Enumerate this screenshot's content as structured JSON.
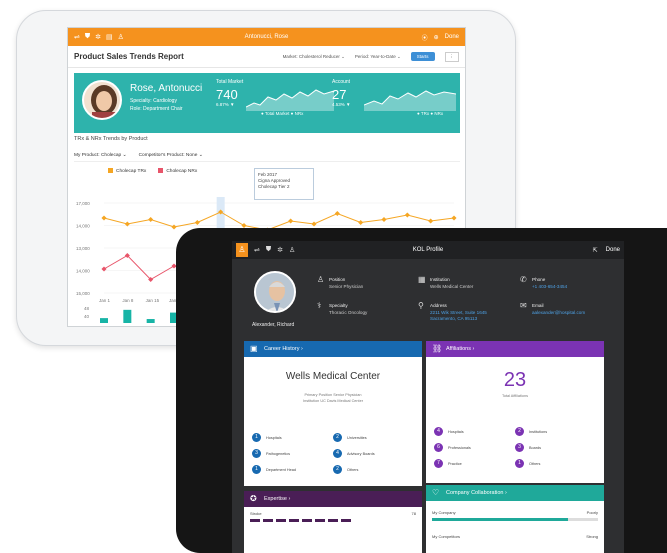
{
  "back_tablet": {
    "top_bar": {
      "title": "Antonucci, Rose",
      "done_label": "Done"
    },
    "header": {
      "report_title": "Product Sales Trends Report",
      "market_label": "Market:",
      "market_value": "Cholesterol Reducer",
      "period_label": "Period:",
      "period_value": "Year-to-Date",
      "apply_label": "Starts",
      "options_label": "⋮"
    },
    "profile": {
      "name": "Rose, Antonucci",
      "specialty": "Specialty: Cardiology",
      "role": "Role: Department Chair"
    },
    "kpi_total_market": {
      "label": "Total Market",
      "value": "740",
      "change": "6.87% ▼",
      "legend": "● Total Market  ● NRx"
    },
    "kpi_account": {
      "label": "Account",
      "value": "27",
      "change": "4.53% ▼",
      "legend": "● TRx  ● NRx"
    },
    "trends": {
      "title": "TRx & NRx Trends by Product",
      "my_product_label": "My Product:",
      "my_product_value": "Cholecap",
      "competitor_label": "Competitor's Product:",
      "competitor_value": "None",
      "legend_trx": "Cholecap TRx",
      "legend_nrx": "Cholecap NRx"
    },
    "tooltip": {
      "date": "Feb 2017",
      "line1": "Cigna Approved",
      "line2": "Cholecap Tier 2"
    },
    "colors": {
      "orange": "#f5921e",
      "teal": "#2eb3ac",
      "red": "#e8556a",
      "bars": "#17b4a6"
    }
  },
  "chart_data": {
    "type": "line",
    "x": [
      "Jan 1",
      "Jan 8",
      "Jan 15",
      "Jan 22",
      "Jan 29",
      "Feb 5",
      "Feb 12",
      "Feb 19",
      "Feb 26",
      "Mar 5",
      "Mar 12",
      "Mar 19",
      "Mar 26",
      "Apr 2",
      "Apr 9",
      "Apr 16"
    ],
    "x_tick_labels": [
      "Jan 1",
      "Jan 8",
      "Jan 15",
      "Jan 22"
    ],
    "y_tick_labels": [
      "17,000",
      "14,000",
      "13,000",
      "14,000",
      "15,000"
    ],
    "series": [
      {
        "name": "Cholecap TRx",
        "values": [
          16000,
          15600,
          15900,
          15400,
          15700,
          16400,
          15500,
          15200,
          15800,
          15600,
          16300,
          15700,
          15900,
          16200,
          15800,
          16000
        ]
      },
      {
        "name": "Cholecap NRx",
        "values": [
          12600,
          13500,
          11900,
          12800,
          12300,
          12600,
          12900,
          13100,
          12500,
          13200,
          12700,
          14400,
          12100,
          12600,
          13400,
          14000
        ]
      }
    ],
    "bars": {
      "y_tick_labels": [
        "48",
        "40",
        "20"
      ],
      "values": [
        28,
        46,
        26,
        40,
        42
      ]
    }
  },
  "front_tablet": {
    "top_bar": {
      "title": "KOL Profile",
      "done_label": "Done"
    },
    "profile": {
      "name": "Alexander, Richard",
      "position_label": "Position",
      "position_value": "Senior Physician",
      "specialty_label": "Specialty",
      "specialty_value": "Thoracic Oncology",
      "institution_label": "Institution",
      "institution_value": "Wells Medical Center",
      "address_label": "Address",
      "address_line1": "2211 Wik Street, Suite 1645",
      "address_line2": "Sacramento, CA 95113",
      "phone_label": "Phone",
      "phone_value": "+1 403-654-3454",
      "email_label": "Email",
      "email_value": "aalexander@hospital.com"
    },
    "career": {
      "header": "Career History  ›",
      "institution": "Wells Medical Center",
      "position_line": "Primary Position   Senior Physician",
      "institution_line": "Institution   UC Davis Medical Center",
      "items": [
        "Hospitals",
        "Universities",
        "Pathogenetics",
        "Advisory Boards",
        "Department Head",
        "Others"
      ]
    },
    "affiliations": {
      "header": "Affiliations  ›",
      "count": "23",
      "count_label": "Total Affiliations",
      "items": [
        "Hospitals",
        "Institutions",
        "Professionals",
        "Boards",
        "Practice",
        "Others"
      ]
    },
    "expertise": {
      "header": "Expertise  ›",
      "row_label": "Stroke",
      "row_value": "78"
    },
    "collaboration": {
      "header": "Company Collaboration  ›",
      "rows": [
        {
          "label": "My Company",
          "value": "Poorly",
          "fill": 0.82
        },
        {
          "label": "My Competitors",
          "value": "Strong",
          "fill": 0.6
        }
      ]
    },
    "colors": {
      "career": "#1769b0",
      "affiliations": "#7b33b3",
      "expertise": "#4a1e56",
      "collaboration": "#1fa99a"
    }
  }
}
